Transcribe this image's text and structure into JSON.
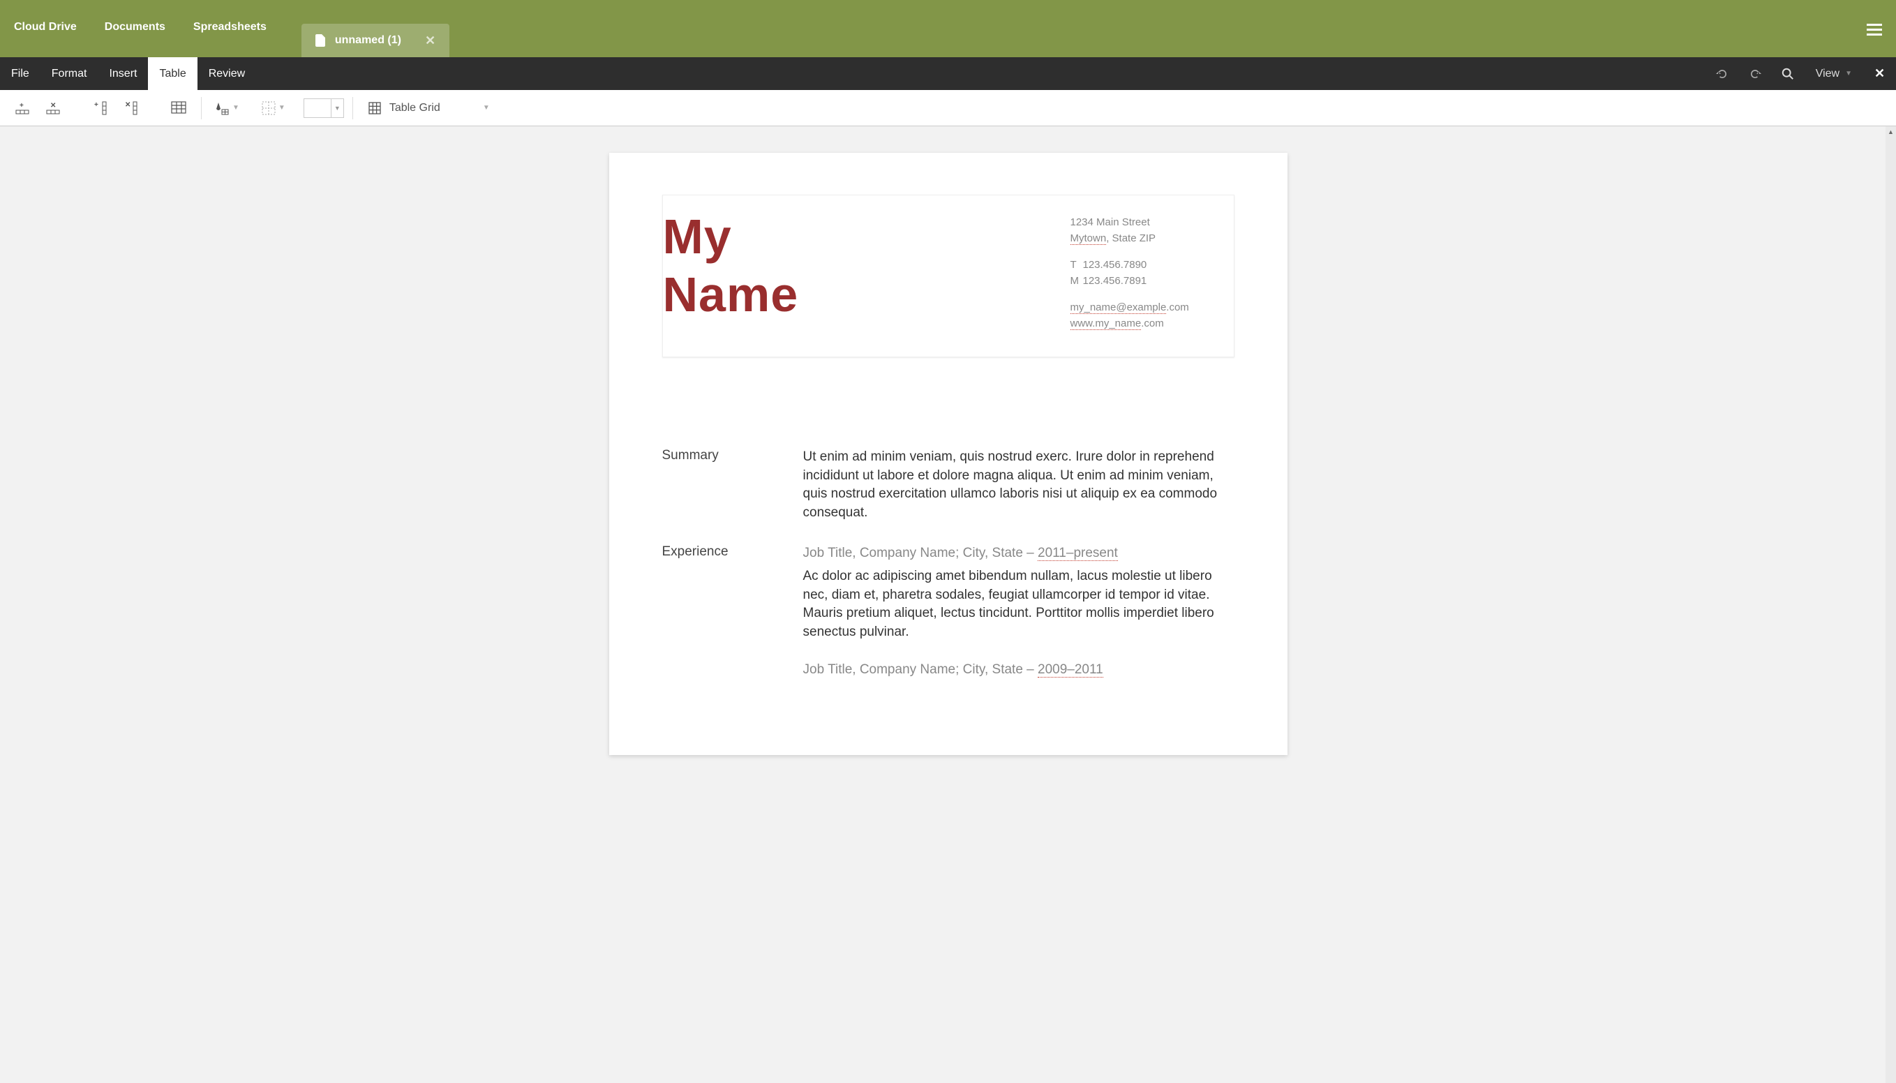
{
  "topNav": {
    "cloudDrive": "Cloud Drive",
    "documents": "Documents",
    "spreadsheets": "Spreadsheets"
  },
  "docTab": {
    "title": "unnamed (1)"
  },
  "menuBar": {
    "file": "File",
    "format": "Format",
    "insert": "Insert",
    "table": "Table",
    "review": "Review",
    "view": "View"
  },
  "toolbar": {
    "styleSelector": "Table Grid"
  },
  "document": {
    "name_line1": "My",
    "name_line2": "Name",
    "contact": {
      "street": "1234 Main Street",
      "cityPart": "Mytown",
      "stateZip": ", State ZIP",
      "phoneT_label": "T",
      "phoneT": "123.456.7890",
      "phoneM_label": "M",
      "phoneM": "123.456.7891",
      "email_part1": "my_name@example",
      "email_part2": ".com",
      "web_part1": "www.my_name",
      "web_part2": ".com"
    },
    "sections": {
      "summaryLabel": "Summary",
      "summaryText": "Ut enim ad minim veniam, quis nostrud exerc. Irure dolor in reprehend incididunt ut labore et dolore magna aliqua. Ut enim ad minim veniam, quis nostrud exercitation ullamco laboris nisi ut aliquip ex ea commodo consequat.",
      "experienceLabel": "Experience",
      "job1_prefix": "Job Title, Company Name; City, State – ",
      "job1_dates": "2011–present",
      "job1_body": "Ac dolor ac adipiscing amet bibendum nullam, lacus molestie ut libero nec, diam et, pharetra sodales, feugiat ullamcorper id tempor id vitae. Mauris pretium aliquet, lectus tincidunt. Porttitor mollis imperdiet libero senectus pulvinar.",
      "job2_prefix": "Job Title, Company Name; City, State – ",
      "job2_dates": "2009–2011"
    }
  }
}
